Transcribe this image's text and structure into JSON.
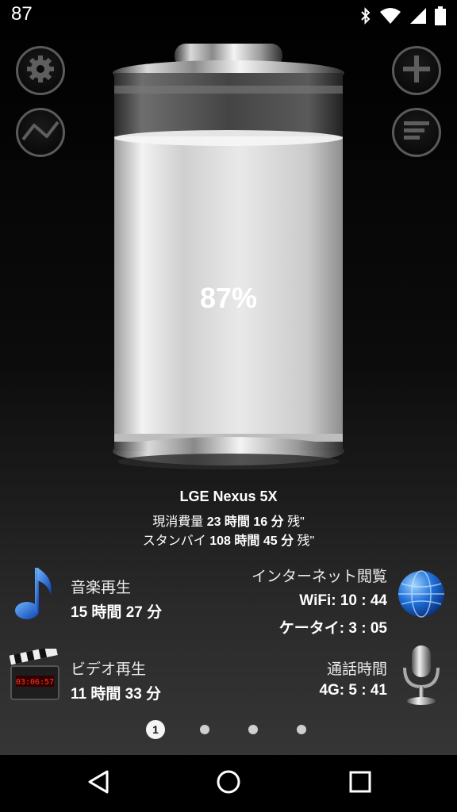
{
  "status_bar": {
    "battery_level_text": "87",
    "icons": [
      "bluetooth-icon",
      "wifi-icon",
      "signal-icon",
      "battery-icon"
    ]
  },
  "battery": {
    "percent_text": "87%",
    "percent": 87
  },
  "device": {
    "name": "LGE Nexus 5X",
    "usage_prefix": "現消費量",
    "usage_value": "23 時間 16 分",
    "usage_suffix": "残\"",
    "standby_prefix": "スタンバイ",
    "standby_value": "108 時間 45 分",
    "standby_suffix": "残\""
  },
  "stats": {
    "music": {
      "label": "音楽再生",
      "value": "15 時間 27 分",
      "icon": "music-note-icon"
    },
    "internet": {
      "label": "インターネット閲覧",
      "wifi": "WiFi: 10 : 44",
      "mobile": "ケータイ: 3 : 05",
      "icon": "globe-icon"
    },
    "video": {
      "label": "ビデオ再生",
      "value": "11 時間 33 分",
      "icon": "clapperboard-icon",
      "clock_text": "03:06:57"
    },
    "call": {
      "label": "通話時間",
      "value": "4G: 5 : 41",
      "icon": "microphone-icon"
    }
  },
  "pager": {
    "active_label": "1",
    "count": 4
  },
  "colors": {
    "accent_blue": "#1e6fd9",
    "background": "#000000"
  }
}
